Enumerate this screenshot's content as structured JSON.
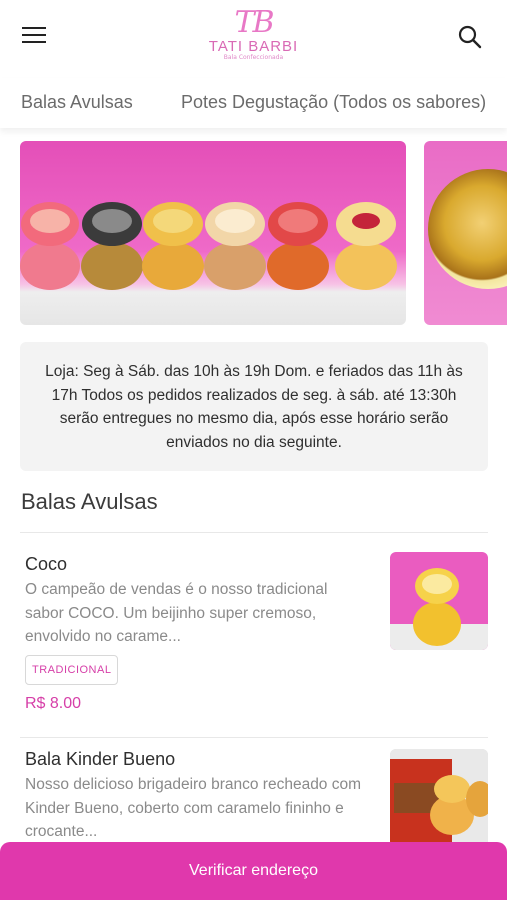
{
  "header": {
    "logo": {
      "monogram": "TB",
      "name": "TATI BARBI",
      "tagline": "Bala Confeccionada"
    },
    "menu_icon": "hamburger-icon",
    "search_icon": "search-icon"
  },
  "tabs": [
    {
      "label": "Balas Avulsas"
    },
    {
      "label": "Potes Degustação (Todos os sabores)"
    }
  ],
  "colors": {
    "accent": "#e038ac",
    "price": "#d63fa8",
    "banner_pink": "#ea5cc0",
    "info_bg": "#f3f3f3"
  },
  "info": {
    "text": "Loja: Seg à Sáb. das 10h às 19h Dom. e feriados das 11h às 17h Todos os pedidos realizados de seg. à sáb. até 13:30h serão entregues no mesmo dia, após esse horário serão enviados no dia seguinte."
  },
  "section": {
    "title": "Balas Avulsas"
  },
  "products": [
    {
      "name": "Coco",
      "description": "O campeão de vendas é o nosso tradicional sabor COCO. Um beijinho super cremoso, envolvido no carame...",
      "badge": "TRADICIONAL",
      "price": "R$ 8.00"
    },
    {
      "name": "Bala Kinder Bueno",
      "description": "Nosso delicioso brigadeiro branco recheado com Kinder Bueno, coberto com caramelo fininho e crocante..."
    }
  ],
  "cta": {
    "label": "Verificar endereço"
  }
}
